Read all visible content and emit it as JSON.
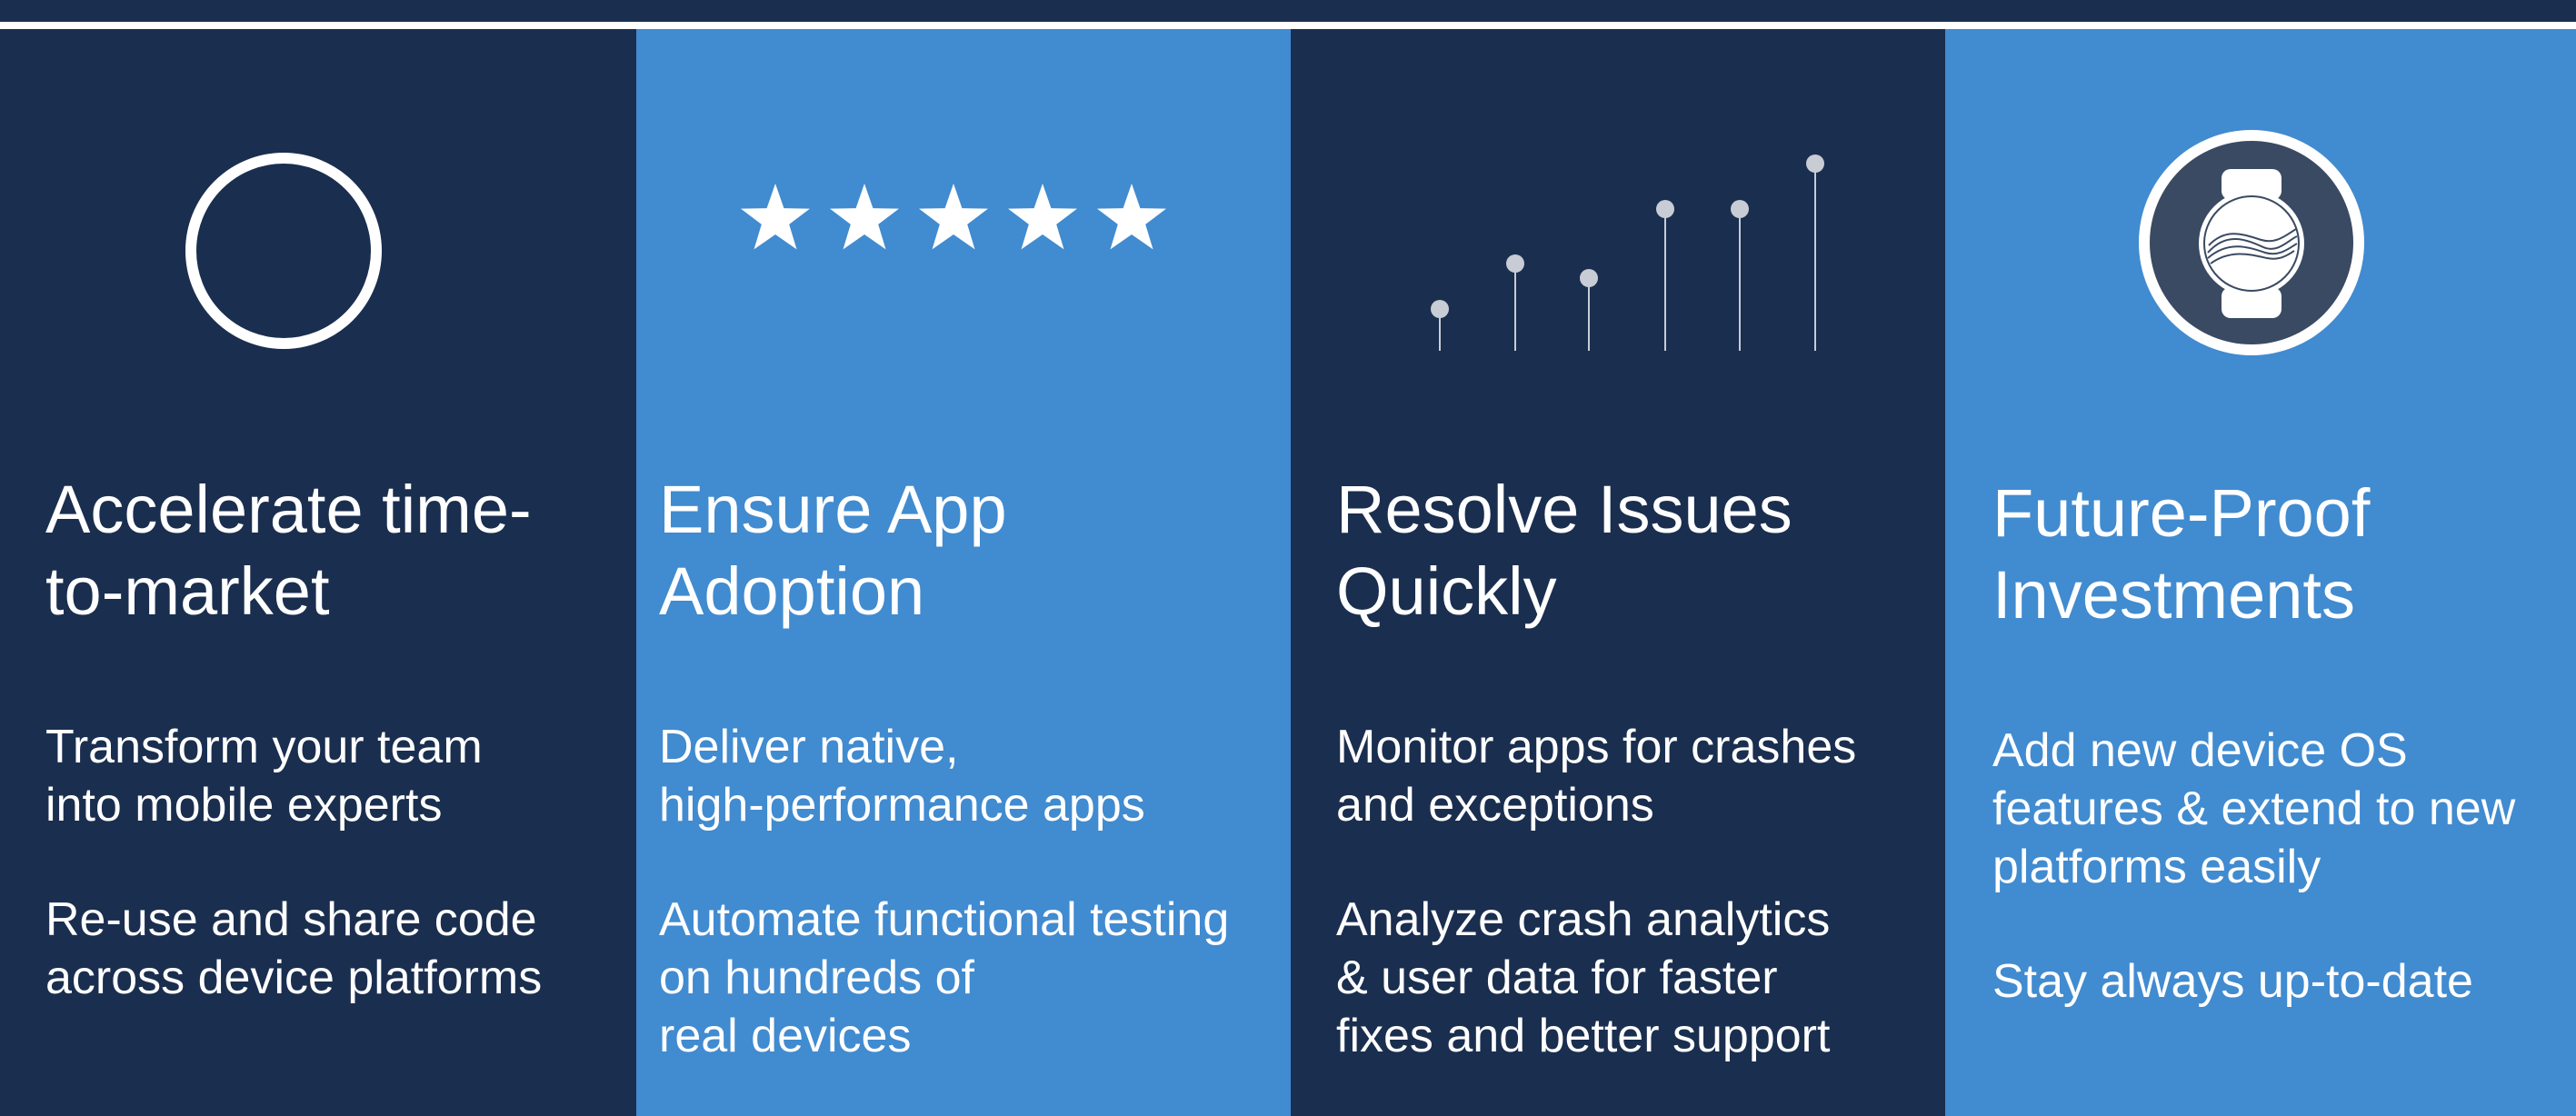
{
  "colors": {
    "navy": "#1a2e4f",
    "blue": "#418bd0",
    "white": "#ffffff",
    "watch_face": "#3a4a62"
  },
  "panels": [
    {
      "icon": "circle-outline-icon",
      "title_lines": [
        "Accelerate time-",
        "to-market"
      ],
      "paragraphs": [
        [
          "Transform your team",
          "into mobile experts"
        ],
        [
          "Re-use and share code",
          "across device platforms"
        ]
      ]
    },
    {
      "icon": "five-stars-icon",
      "title_lines": [
        "Ensure App",
        "Adoption"
      ],
      "paragraphs": [
        [
          "Deliver native,",
          "high-performance apps"
        ],
        [
          "Automate functional testing",
          "on hundreds of",
          "real devices"
        ]
      ]
    },
    {
      "icon": "lollipop-chart-icon",
      "title_lines": [
        "Resolve Issues",
        "Quickly"
      ],
      "paragraphs": [
        [
          "Monitor apps for crashes",
          "and exceptions"
        ],
        [
          "Analyze crash analytics",
          "& user data for faster",
          "fixes and better support"
        ]
      ]
    },
    {
      "icon": "smartwatch-icon",
      "title_lines": [
        "Future-Proof",
        "Investments"
      ],
      "paragraphs": [
        [
          "Add new device OS",
          "features & extend to new",
          "platforms easily"
        ],
        [
          "Stay always up-to-date"
        ]
      ]
    }
  ]
}
